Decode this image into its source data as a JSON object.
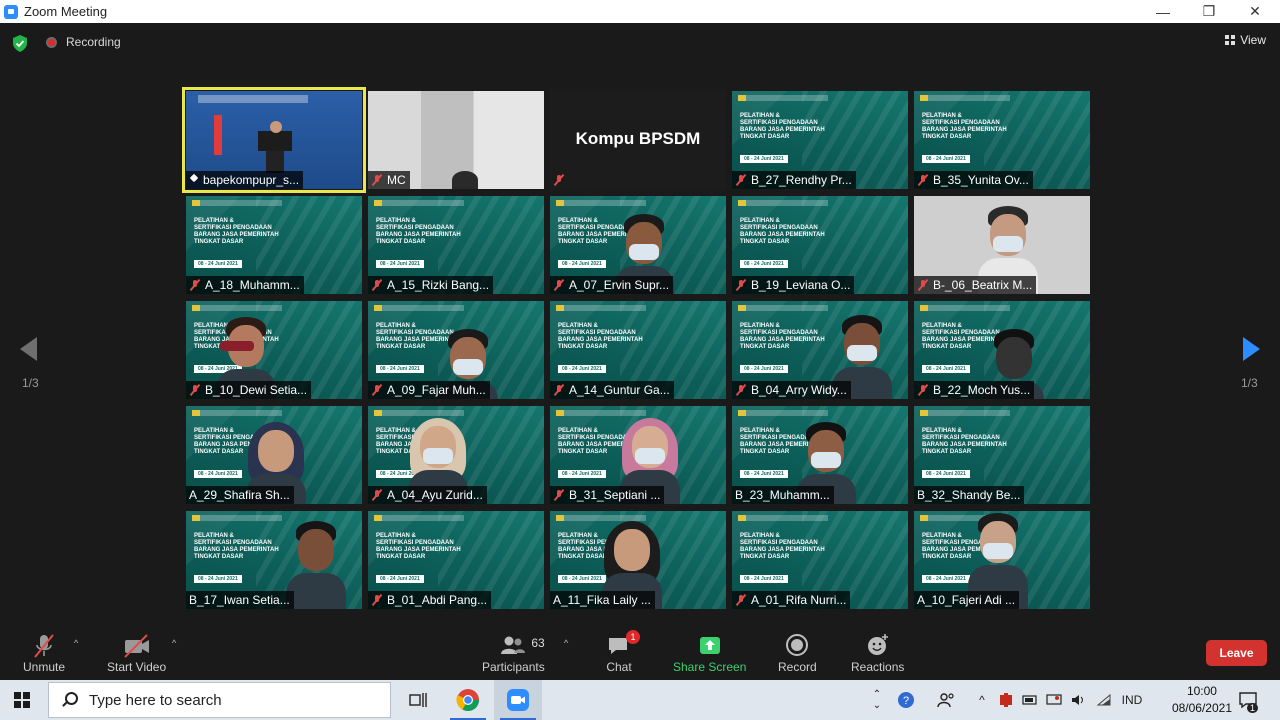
{
  "window": {
    "title": "Zoom Meeting",
    "minimize": "—",
    "restore": "❐",
    "close": "✕"
  },
  "meeting_top": {
    "recording_label": "Recording",
    "view_label": "View"
  },
  "slide": {
    "title_lines": [
      "PELATIHAN &",
      "SERTIFIKASI PENGADAAN",
      "BARANG JASA PEMERINTAH",
      "TINGKAT DASAR"
    ],
    "dates": "08 - 24 Juni 2021"
  },
  "kompu_text": "Kompu BPSDM",
  "participants_tiles": [
    {
      "name": "bapekompupr_s...",
      "muted": false,
      "pinned": true,
      "style": "stage-blue",
      "active": true
    },
    {
      "name": "MC",
      "muted": true,
      "style": "gray-room"
    },
    {
      "name": "",
      "muted": true,
      "style": "black-kompu"
    },
    {
      "name": "B_27_Rendhy Pr...",
      "muted": true,
      "style": "slide"
    },
    {
      "name": "B_35_Yunita Ov...",
      "muted": true,
      "style": "slide"
    },
    {
      "name": "A_18_Muhamm...",
      "muted": true,
      "style": "slide"
    },
    {
      "name": "A_15_Rizki Bang...",
      "muted": true,
      "style": "slide"
    },
    {
      "name": "A_07_Ervin Supr...",
      "muted": true,
      "style": "slide-person"
    },
    {
      "name": "B_19_Leviana O...",
      "muted": true,
      "style": "slide"
    },
    {
      "name": "B-_06_Beatrix M...",
      "muted": true,
      "style": "gray-person"
    },
    {
      "name": "B_10_Dewi Setia...",
      "muted": true,
      "style": "slide-person"
    },
    {
      "name": "A_09_Fajar Muh...",
      "muted": true,
      "style": "slide-person"
    },
    {
      "name": "A_14_Guntur Ga...",
      "muted": true,
      "style": "slide"
    },
    {
      "name": "B_04_Arry Widy...",
      "muted": true,
      "style": "slide-person"
    },
    {
      "name": "B_22_Moch Yus...",
      "muted": true,
      "style": "slide-person"
    },
    {
      "name": "A_29_Shafira Sh...",
      "muted": false,
      "style": "slide-person"
    },
    {
      "name": "A_04_Ayu Zurid...",
      "muted": true,
      "style": "slide-person"
    },
    {
      "name": "B_31_Septiani ...",
      "muted": true,
      "style": "slide-person"
    },
    {
      "name": "B_23_Muhamm...",
      "muted": false,
      "style": "slide-person"
    },
    {
      "name": "B_32_Shandy Be...",
      "muted": false,
      "style": "slide"
    },
    {
      "name": "B_17_Iwan Setia...",
      "muted": false,
      "style": "slide-person"
    },
    {
      "name": "B_01_Abdi Pang...",
      "muted": true,
      "style": "slide"
    },
    {
      "name": "A_11_Fika Laily ...",
      "muted": false,
      "style": "slide-person"
    },
    {
      "name": "A_01_Rifa Nurri...",
      "muted": true,
      "style": "slide"
    },
    {
      "name": "A_10_Fajeri Adi ...",
      "muted": false,
      "style": "slide-person"
    }
  ],
  "pager": {
    "left": "1/3",
    "right": "1/3"
  },
  "toolbar": {
    "unmute": "Unmute",
    "start_video": "Start Video",
    "participants": "Participants",
    "participants_count": "63",
    "chat": "Chat",
    "chat_badge": "1",
    "share_screen": "Share Screen",
    "record": "Record",
    "reactions": "Reactions",
    "leave": "Leave",
    "caret": "^"
  },
  "taskbar": {
    "search_placeholder": "Type here to search",
    "language": "IND",
    "time": "10:00",
    "date": "08/06/2021",
    "notification_count": "1"
  },
  "colors": {
    "zoom_blue": "#2d8cff",
    "leave_red": "#d3332e",
    "share_green": "#3bd16f",
    "active_border": "#e8e84c"
  }
}
